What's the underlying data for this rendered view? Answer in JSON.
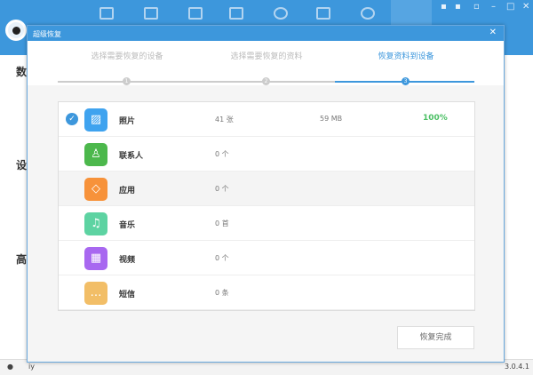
{
  "app": {
    "side_chars": [
      "数",
      "设",
      "高"
    ],
    "status_left": "iy",
    "version": "3.0.4.1"
  },
  "dialog": {
    "title": "超级恢复",
    "close": "✕",
    "steps": [
      {
        "label": "选择需要恢复的设备",
        "num": "1"
      },
      {
        "label": "选择需要恢复的资料",
        "num": "2"
      },
      {
        "label": "恢复资料到设备",
        "num": "3"
      }
    ],
    "items": [
      {
        "name": "照片",
        "count": "41 张",
        "size": "59 MB",
        "percent": "100%",
        "checked": true,
        "icon": "image-icon",
        "color": "#3fa3ef",
        "glyph": "▨"
      },
      {
        "name": "联系人",
        "count": "0 个",
        "icon": "contact-icon",
        "color": "#4cb84c",
        "glyph": "♙"
      },
      {
        "name": "应用",
        "count": "0 个",
        "icon": "apps-icon",
        "color": "#f7923a",
        "glyph": "◇"
      },
      {
        "name": "音乐",
        "count": "0 首",
        "icon": "music-icon",
        "color": "#5dd3a2",
        "glyph": "♫"
      },
      {
        "name": "视频",
        "count": "0 个",
        "icon": "video-icon",
        "color": "#a868f0",
        "glyph": "▦"
      },
      {
        "name": "短信",
        "count": "0 条",
        "icon": "message-icon",
        "color": "#f2be67",
        "glyph": "…"
      }
    ],
    "done_button": "恢复完成"
  }
}
